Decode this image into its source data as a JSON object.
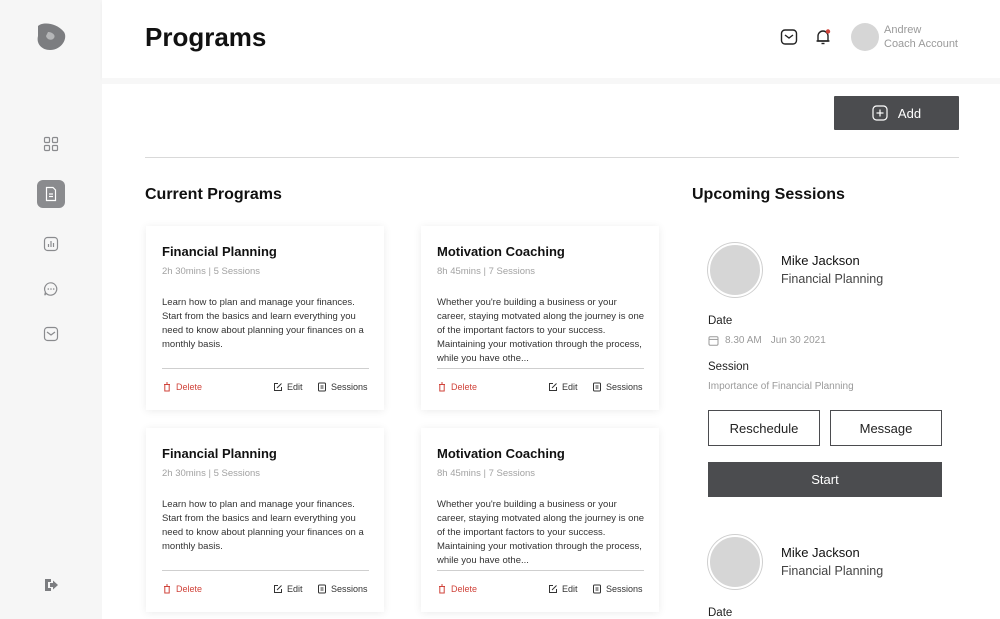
{
  "header": {
    "title": "Programs",
    "user_name": "Andrew",
    "user_role": "Coach Account",
    "icons": [
      "mail-icon",
      "bell-icon"
    ]
  },
  "sidebar": {
    "items": [
      {
        "name": "dashboard",
        "icon": "grid-icon",
        "active": false
      },
      {
        "name": "programs",
        "icon": "document-icon",
        "active": true
      },
      {
        "name": "analytics",
        "icon": "chart-icon",
        "active": false
      },
      {
        "name": "chat",
        "icon": "chat-icon",
        "active": false
      },
      {
        "name": "inbox",
        "icon": "mail-icon",
        "active": false
      }
    ],
    "logout_icon": "logout-icon"
  },
  "toolbar": {
    "add_label": "Add"
  },
  "current_programs": {
    "title": "Current Programs",
    "cards": [
      {
        "title": "Financial Planning",
        "meta": "2h 30mins | 5 Sessions",
        "description": "Learn how to plan and manage your finances. Start from the basics and learn everything you need to know about planning your finances on a monthly basis.",
        "delete_label": "Delete",
        "edit_label": "Edit",
        "sessions_label": "Sessions"
      },
      {
        "title": "Motivation Coaching",
        "meta": "8h 45mins | 7 Sessions",
        "description": "Whether you're building a business or your career, staying motvated along the journey is one of the important factors to your success. Maintaining your motivation through the process, while you have othe...",
        "delete_label": "Delete",
        "edit_label": "Edit",
        "sessions_label": "Sessions"
      },
      {
        "title": "Financial Planning",
        "meta": "2h 30mins | 5 Sessions",
        "description": "Learn how to plan and manage your finances. Start from the basics and learn everything you need to know about planning your finances on a monthly basis.",
        "delete_label": "Delete",
        "edit_label": "Edit",
        "sessions_label": "Sessions"
      },
      {
        "title": "Motivation Coaching",
        "meta": "8h 45mins | 7 Sessions",
        "description": "Whether you're building a business or your career, staying motvated along the journey is one of the important factors to your success. Maintaining your motivation through the process, while you have othe...",
        "delete_label": "Delete",
        "edit_label": "Edit",
        "sessions_label": "Sessions"
      }
    ]
  },
  "upcoming": {
    "title": "Upcoming Sessions",
    "sessions": [
      {
        "name": "Mike Jackson",
        "program": "Financial Planning",
        "date_label": "Date",
        "time": "8.30 AM",
        "date": "Jun 30 2021",
        "session_label": "Session",
        "session_topic": "Importance of Financial Planning",
        "reschedule_label": "Reschedule",
        "message_label": "Message",
        "start_label": "Start"
      },
      {
        "name": "Mike Jackson",
        "program": "Financial Planning",
        "date_label": "Date"
      }
    ]
  },
  "colors": {
    "primary_dark": "#4b4c4f",
    "danger": "#d0433a",
    "sidebar_bg": "#f6f6f6"
  }
}
